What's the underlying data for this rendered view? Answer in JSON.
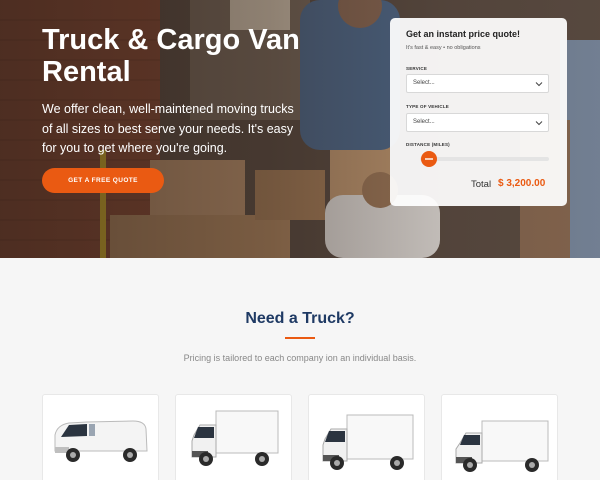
{
  "hero": {
    "title": "Truck & Cargo Van Rental",
    "description": "We offer clean, well-maintened moving trucks of all sizes to best serve your needs. It's easy for you to get where you're going.",
    "cta_label": "GET A FREE QUOTE"
  },
  "quote": {
    "title": "Get an instant price quote!",
    "subtitle": "It's fast & easy • no obligations",
    "service_label": "SERVICE",
    "service_value": "Select...",
    "vehicle_label": "TYPE OF VEHICLE",
    "vehicle_value": "Select...",
    "distance_label": "DISTANCE (MILES)",
    "distance_level": 0.0,
    "total_label": "Total",
    "total_value": "$ 3,200.00"
  },
  "section": {
    "title": "Need a Truck?",
    "subtitle": "Pricing is tailored to each company ion an individual basis."
  },
  "vehicles": [
    {
      "icon": "cargo-van-icon"
    },
    {
      "icon": "box-truck-icon"
    },
    {
      "icon": "box-truck-icon"
    },
    {
      "icon": "box-truck-icon"
    }
  ],
  "colors": {
    "accent": "#ea5a12",
    "heading": "#1f3a64",
    "page_bg": "#f6f6f6"
  }
}
